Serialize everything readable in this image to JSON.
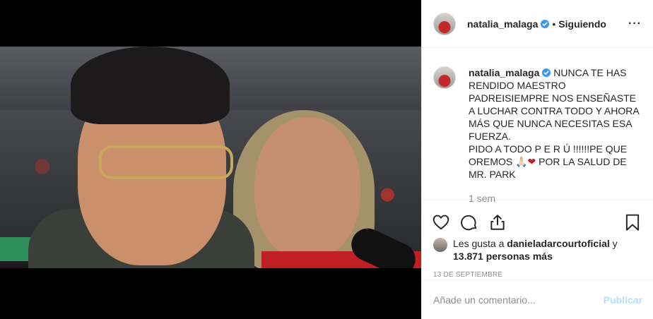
{
  "post": {
    "username": "natalia_malaga",
    "follow_status": "Siguiendo",
    "more_label": "···"
  },
  "caption": {
    "username": "natalia_malaga",
    "text": "NUNCA TE HAS RENDIDO MAESTRO PADREISIEMPRE NOS ENSEÑASTE A LUCHAR CONTRA TODO Y AHORA MÁS QUE NUNCA NECESITAS ESA FUERZA.\nPIDO A TODO P E R Ú !!!!!!PE QUE OREMOS ",
    "emoji": "🙏🏻❤",
    "text_end": " POR LA SALUD DE MR. PARK",
    "time": "1 sem"
  },
  "likes": {
    "prefix": "Les gusta a ",
    "user": "danieladarcourtoficial",
    "connector": " y",
    "count": "13.871 personas más"
  },
  "date": "13 DE SEPTIEMBRE",
  "comment_box": {
    "placeholder": "Añade un comentario...",
    "publish_label": "Publicar"
  },
  "icons": {
    "verified": "verified-badge-icon",
    "like": "heart-outline-icon",
    "comment": "comment-bubble-icon",
    "share": "share-icon",
    "save": "bookmark-icon"
  },
  "colors": {
    "verified": "#3897f0",
    "text": "#262626",
    "muted": "#8e8e8e",
    "publish_disabled": "#b2dffc",
    "heart_emoji": "#be1e2d"
  }
}
